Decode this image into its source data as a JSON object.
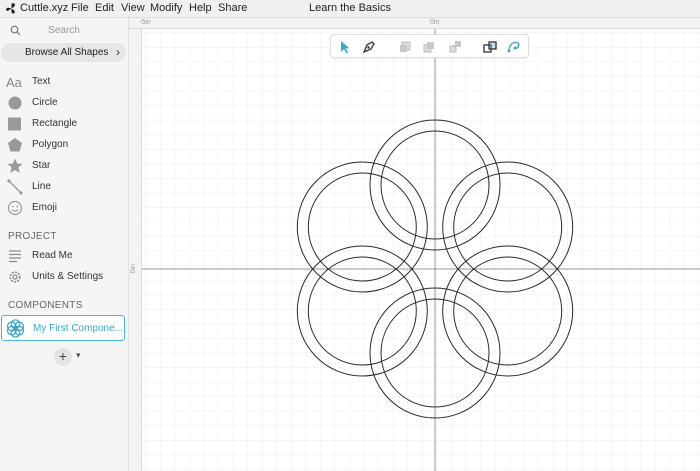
{
  "app": {
    "brand": "Cuttle.xyz",
    "menus": [
      "File",
      "Edit",
      "View",
      "Modify",
      "Help",
      "Share"
    ],
    "document_title": "Learn the Basics"
  },
  "sidebar": {
    "search_placeholder": "Search",
    "browse_label": "Browse All Shapes",
    "shapes": [
      {
        "label": "Text",
        "icon": "text-icon"
      },
      {
        "label": "Circle",
        "icon": "circle-icon"
      },
      {
        "label": "Rectangle",
        "icon": "rectangle-icon"
      },
      {
        "label": "Polygon",
        "icon": "polygon-icon"
      },
      {
        "label": "Star",
        "icon": "star-icon"
      },
      {
        "label": "Line",
        "icon": "line-icon"
      },
      {
        "label": "Emoji",
        "icon": "emoji-icon"
      }
    ],
    "project_title": "PROJECT",
    "project_items": [
      {
        "label": "Read Me",
        "icon": "document-icon"
      },
      {
        "label": "Units & Settings",
        "icon": "gear-icon"
      }
    ],
    "components_title": "COMPONENTS",
    "components": [
      {
        "label": "My First Compone...",
        "icon": "flower-icon"
      }
    ],
    "add_button": "+"
  },
  "canvas": {
    "ruler_top_labels": [
      "-5in",
      "0in"
    ],
    "ruler_left_label": "0in",
    "toolbar_tools": [
      "pointer-tool-icon",
      "pen-tool-icon",
      "bring-back-icon",
      "bring-forward-icon",
      "bring-front-icon",
      "boolean-icon",
      "edit-path-icon"
    ]
  },
  "colors": {
    "accent": "#3aa8c9",
    "text_dark": "#222222",
    "canvas_bg": "#ffffff",
    "grid": "#ebebeb"
  }
}
